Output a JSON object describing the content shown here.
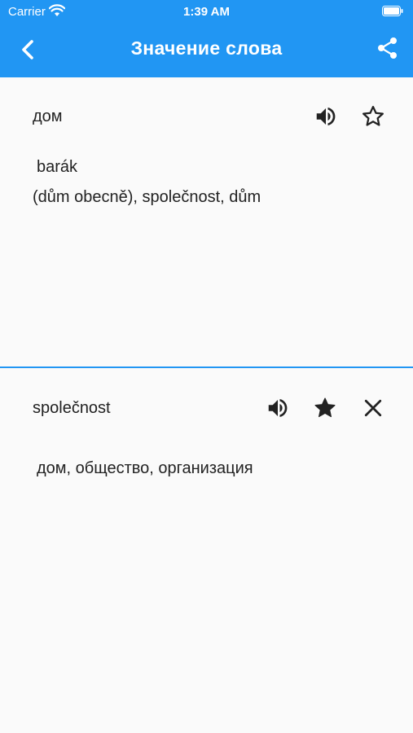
{
  "status_bar": {
    "carrier": "Carrier",
    "time": "1:39 AM"
  },
  "app_bar": {
    "title": "Значение слова",
    "color": "#2196f3"
  },
  "entries": [
    {
      "word": "дом",
      "favorite": false,
      "lines": [
        "barák",
        "(dům obecně), společnost, dům"
      ]
    },
    {
      "word": "společnost",
      "favorite": true,
      "lines": [
        "дом, общество, организация"
      ]
    }
  ],
  "icons": {
    "back": "chevron-left-icon",
    "share": "share-icon",
    "speaker": "volume-up-icon",
    "star_outline": "star-outline-icon",
    "star_filled": "star-filled-icon",
    "close": "close-icon"
  }
}
